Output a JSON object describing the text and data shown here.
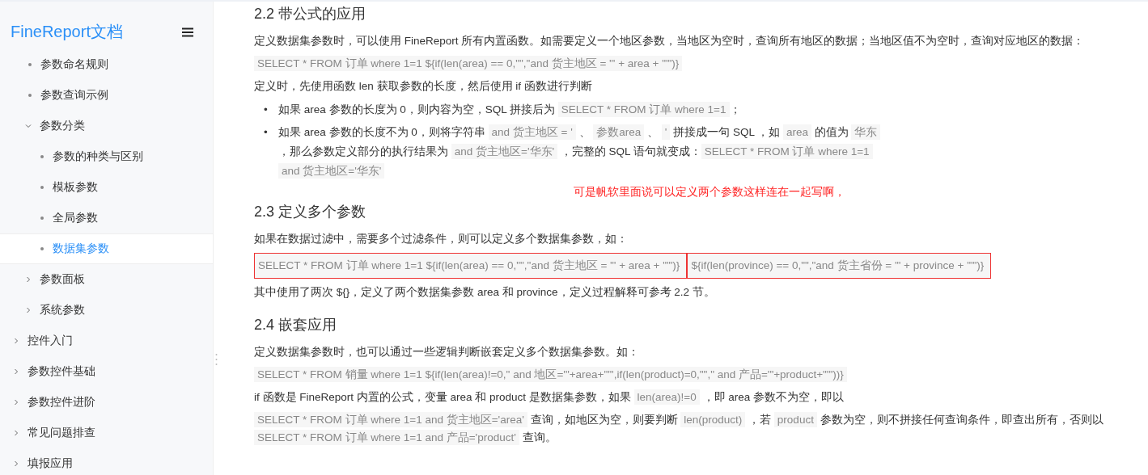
{
  "sidebar": {
    "logo": "FineReport文档",
    "tree": [
      {
        "children": [
          {
            "children": [
              {
                "kind": "leaf",
                "label": "参数命名规则",
                "selected": false
              },
              {
                "kind": "leaf",
                "label": "参数查询示例",
                "selected": false
              },
              {
                "kind": "folder",
                "label": "参数分类",
                "expanded": true,
                "children": [
                  {
                    "kind": "leaf",
                    "label": "参数的种类与区别",
                    "selected": false
                  },
                  {
                    "kind": "leaf",
                    "label": "模板参数",
                    "selected": false
                  },
                  {
                    "kind": "leaf",
                    "label": "全局参数",
                    "selected": false
                  },
                  {
                    "kind": "leaf",
                    "label": "数据集参数",
                    "selected": true
                  }
                ]
              },
              {
                "kind": "folder",
                "label": "参数面板",
                "expanded": false
              },
              {
                "kind": "folder",
                "label": "系统参数",
                "expanded": false
              }
            ]
          },
          {
            "kind": "folder",
            "label": "控件入门",
            "expanded": false
          },
          {
            "kind": "folder",
            "label": "参数控件基础",
            "expanded": false
          },
          {
            "kind": "folder",
            "label": "参数控件进阶",
            "expanded": false
          },
          {
            "kind": "folder",
            "label": "常见问题排查",
            "expanded": false
          }
        ]
      },
      {
        "kind": "folder",
        "label": "填报应用",
        "expanded": false
      }
    ]
  },
  "content": [
    {
      "kind": "heading",
      "text": "2.2 带公式的应用"
    },
    {
      "kind": "para",
      "lines": [
        [
          {
            "kind": "text",
            "text": "定义数据集参数时，可以使用 FineReport 所有内置函数。如需要定义一个地区参数，当地区为空时，查询所有地区的数据；当地区值不为空时，查询对应地区的数据："
          }
        ]
      ]
    },
    {
      "kind": "para",
      "lines": [
        [
          {
            "kind": "code",
            "text": "SELECT * FROM 订单 where 1=1 ${if(len(area) == 0,\"\",\"and 货主地区 = '\" + area + \"'\")}"
          }
        ]
      ]
    },
    {
      "kind": "para",
      "lines": [
        [
          {
            "kind": "text",
            "text": "定义时，先使用函数 len 获取参数的长度，然后使用 if 函数进行判断"
          }
        ]
      ]
    },
    {
      "kind": "bullets",
      "items": [
        {
          "marker": "•",
          "lines": [
            [
              {
                "kind": "text",
                "text": "如果 area 参数的长度为 0，则内容为空，SQL 拼接后为 "
              },
              {
                "kind": "code",
                "text": "SELECT * FROM 订单 where 1=1"
              },
              {
                "kind": "text",
                "text": "；"
              }
            ]
          ]
        },
        {
          "marker": "•",
          "lines": [
            [
              {
                "kind": "text",
                "text": "如果 area 参数的长度不为 0，则将字符串 "
              },
              {
                "kind": "code",
                "text": "and 货主地区 = '"
              },
              {
                "kind": "text",
                "text": " 、 "
              },
              {
                "kind": "code",
                "text": "参数area"
              },
              {
                "kind": "text",
                "text": " 、 "
              },
              {
                "kind": "code",
                "text": "'"
              },
              {
                "kind": "text",
                "text": " 拼接成一句 SQL ，如 "
              },
              {
                "kind": "code",
                "text": "area"
              },
              {
                "kind": "text",
                "text": " 的值为 "
              },
              {
                "kind": "code",
                "text": "华东"
              }
            ],
            [
              {
                "kind": "text",
                "text": "，那么参数定义部分的执行结果为 "
              },
              {
                "kind": "code",
                "text": "and 货主地区='华东'"
              },
              {
                "kind": "text",
                "text": " ，完整的 SQL 语句就变成："
              },
              {
                "kind": "code",
                "text": "SELECT * FROM 订单 where 1=1"
              }
            ],
            [
              {
                "kind": "code",
                "text": "and 货主地区='华东'"
              }
            ]
          ]
        }
      ]
    },
    {
      "kind": "annotation",
      "text": "可是帆软里面说可以定义两个参数这样连在一起写啊，"
    },
    {
      "kind": "heading",
      "text": "2.3 定义多个参数"
    },
    {
      "kind": "para",
      "lines": [
        [
          {
            "kind": "text",
            "text": "如果在数据过滤中，需要多个过滤条件，则可以定义多个数据集参数，如："
          }
        ]
      ]
    },
    {
      "kind": "para",
      "lines": [
        [
          {
            "kind": "boxed_code",
            "text": "SELECT * FROM 订单 where 1=1 ${if(len(area) == 0,\"\",\"and 货主地区 = '\" + area + \"'\")}"
          },
          {
            "kind": "boxed_code",
            "text": "${if(len(province) == 0,\"\",\"and 货主省份 = '\" + province + \"'\")}"
          }
        ]
      ]
    },
    {
      "kind": "para",
      "lines": [
        [
          {
            "kind": "text",
            "text": "其中使用了两次 ${}，定义了两个数据集参数 area 和 province，定义过程解释可参考 2.2 节。"
          }
        ]
      ]
    },
    {
      "kind": "heading",
      "text": "2.4 嵌套应用"
    },
    {
      "kind": "para",
      "lines": [
        [
          {
            "kind": "text",
            "text": "定义数据集参数时，也可以通过一些逻辑判断嵌套定义多个数据集参数。如："
          }
        ]
      ]
    },
    {
      "kind": "para",
      "lines": [
        [
          {
            "kind": "code",
            "text": "SELECT  * FROM 销量 where 1=1 ${if(len(area)!=0,\" and 地区='\"+area+\"'\",if(len(product)=0,\"\",\" and 产品='\"+product+\"'\"))}"
          }
        ]
      ]
    },
    {
      "kind": "para",
      "lines": [
        [
          {
            "kind": "text",
            "text": "if 函数是 FineReport 内置的公式，变量 area 和 product 是数据集参数，如果 "
          },
          {
            "kind": "code",
            "text": "len(area)!=0"
          },
          {
            "kind": "text",
            "text": " ，即 area 参数不为空，即以"
          }
        ]
      ]
    },
    {
      "kind": "para",
      "lines": [
        [
          {
            "kind": "code",
            "text": "SELECT * FROM 订单 where 1=1 and 货主地区='area'"
          },
          {
            "kind": "text",
            "text": " 查询，如地区为空，则要判断 "
          },
          {
            "kind": "code",
            "text": "len(product)"
          },
          {
            "kind": "text",
            "text": " ，若 "
          },
          {
            "kind": "code",
            "text": "product"
          },
          {
            "kind": "text",
            "text": " 参数为空，则不拼接任何查询条件，即查出所有，否则以"
          }
        ],
        [
          {
            "kind": "code",
            "text": "SELECT * FROM 订单 where 1=1 and 产品='product'"
          },
          {
            "kind": "text",
            "text": " 查询。"
          }
        ]
      ]
    }
  ]
}
